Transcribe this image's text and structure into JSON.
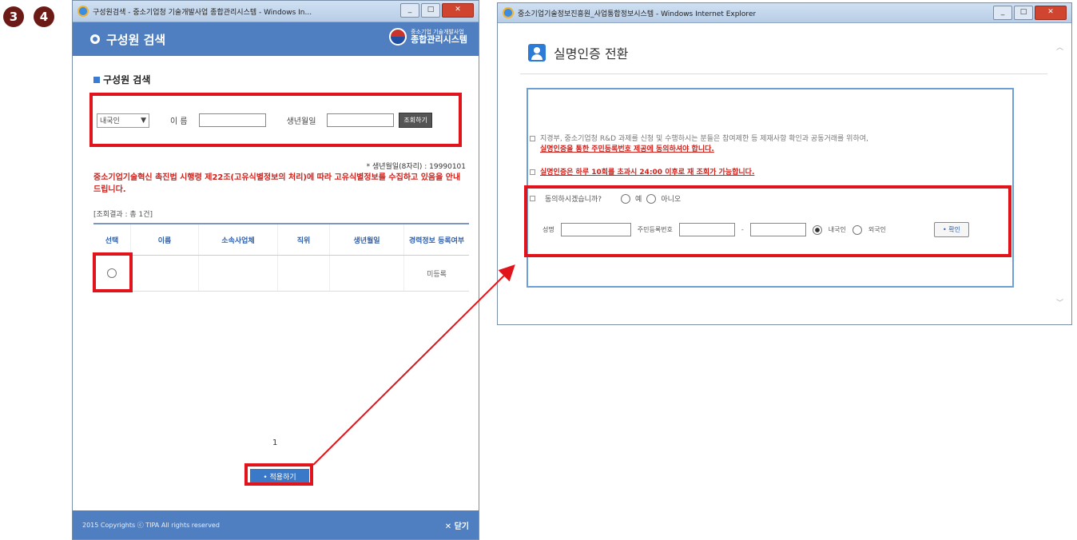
{
  "steps": [
    "3",
    "4"
  ],
  "left_window": {
    "title": "구성원검색 - 중소기업청 기술개발사업 종합관리시스템 - Windows In...",
    "header_title": "구성원 검색",
    "brand_small": "중소기업 기술개발사업",
    "brand_main": "종합관리시스템",
    "section_title": "구성원 검색",
    "search": {
      "select_value": "내국인",
      "name_label": "이 름",
      "birth_label": "생년월일",
      "search_button": "조회하기"
    },
    "birth_note": "* 생년월일(8자리) : 19990101",
    "notice": "중소기업기술혁신 촉진법 시행령 제22조(고유식별정보의 처리)에 따라 고유식별정보를 수집하고 있음을 안내 드립니다.",
    "result_count": "[조회결과 : 총 1건]",
    "table": {
      "headers": [
        "선택",
        "이름",
        "소속사업체",
        "직위",
        "생년월일",
        "경력정보 등록여부"
      ],
      "rows": [
        [
          "",
          "",
          "",
          "",
          "",
          "미등록"
        ]
      ]
    },
    "page_number": "1",
    "apply_button": "• 적용하기",
    "footer_text": "2015 Copyrights ⓒ TIPA All rights reserved",
    "close_button": "✕ 닫기"
  },
  "right_window": {
    "title": "중소기업기술정보진흥원_사업통합정보시스템 - Windows Internet Explorer",
    "heading": "실명인증 전환",
    "info1": "지경부, 중소기업청 R&D 과제를 신청 및 수행하시는 분들은 참여제한 등 제재사항 확인과 공동거래를 위하여,",
    "info1_red": "실명인증을 통한 주민등록번호 제공에 동의하셔야 합니다.",
    "info2_red": "실명인증은 하루 10회를 초과시 24:00 이후로 재 조회가 가능합니다.",
    "consent_question": "동의하시겠습니까?",
    "yes_label": "예",
    "no_label": "아니오",
    "name_label": "성명",
    "rrn_label": "주민등록번호",
    "rrn_separator": "-",
    "domestic_label": "내국인",
    "foreign_label": "외국인",
    "confirm_button": "• 확인"
  },
  "colors": {
    "header_blue": "#4f7fc0",
    "highlight_red": "#e0141a",
    "notice_red": "#d0201a",
    "step_badge": "#6b1a16"
  }
}
